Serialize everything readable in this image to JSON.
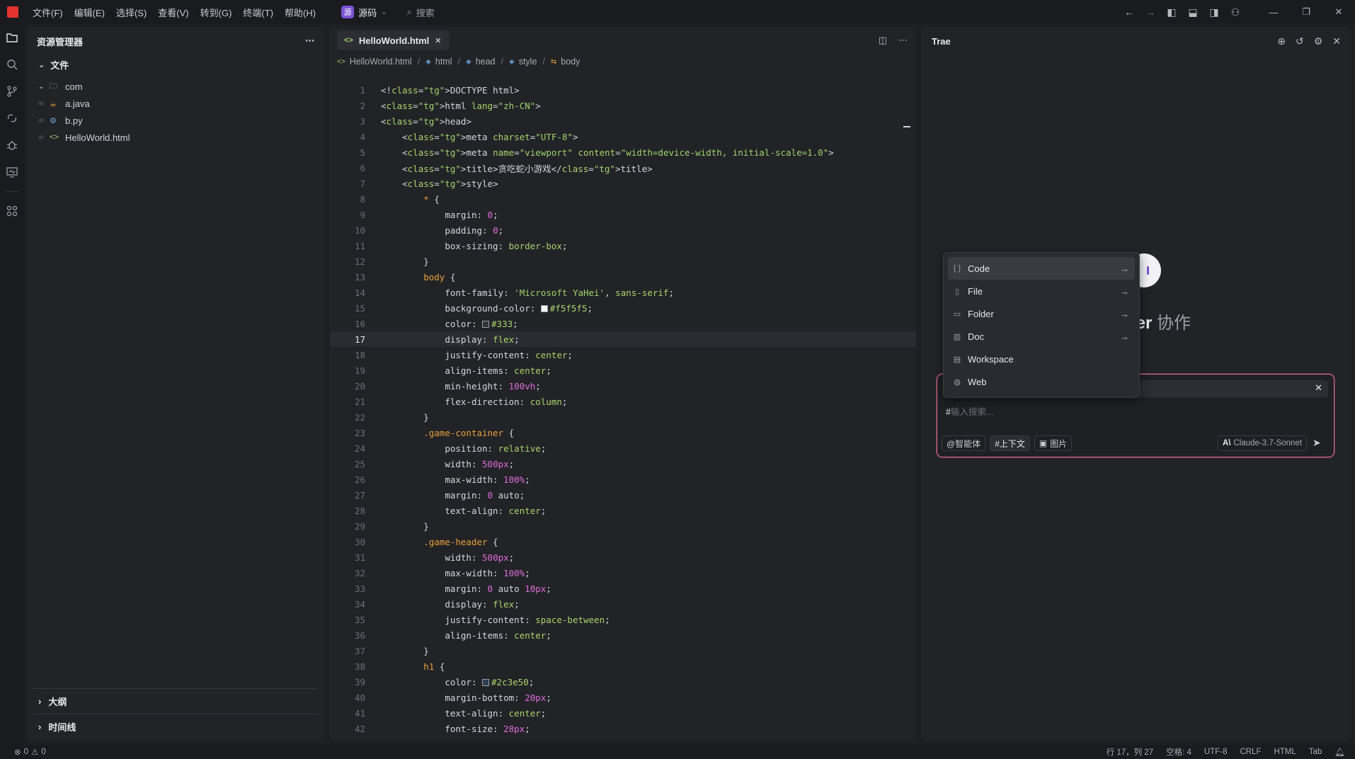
{
  "titlebar": {
    "menus": [
      "文件(F)",
      "编辑(E)",
      "选择(S)",
      "查看(V)",
      "转到(G)",
      "终端(T)",
      "帮助(H)"
    ],
    "source_badge": "源",
    "source_label": "源码",
    "search_label": "搜索"
  },
  "explorer": {
    "title": "资源管理器",
    "folder": "文件",
    "items": [
      {
        "name": "com",
        "type": "folder"
      },
      {
        "name": "a.java",
        "type": "java"
      },
      {
        "name": "b.py",
        "type": "python"
      },
      {
        "name": "HelloWorld.html",
        "type": "html"
      }
    ],
    "outline": "大纲",
    "timeline": "时间线"
  },
  "editor": {
    "tab": "HelloWorld.html",
    "breadcrumbs": [
      "HelloWorld.html",
      "html",
      "head",
      "style",
      "body"
    ],
    "current_line": 17,
    "lines": [
      "<!DOCTYPE html>",
      "<html lang=\"zh-CN\">",
      "<head>",
      "    <meta charset=\"UTF-8\">",
      "    <meta name=\"viewport\" content=\"width=device-width, initial-scale=1.0\">",
      "    <title>贪吃蛇小游戏</title>",
      "    <style>",
      "        * {",
      "            margin: 0;",
      "            padding: 0;",
      "            box-sizing: border-box;",
      "        }",
      "        body {",
      "            font-family: 'Microsoft YaHei', sans-serif;",
      "            background-color: #f5f5f5;",
      "            color: #333;",
      "            display: flex;",
      "            justify-content: center;",
      "            align-items: center;",
      "            min-height: 100vh;",
      "            flex-direction: column;",
      "        }",
      "        .game-container {",
      "            position: relative;",
      "            width: 500px;",
      "            max-width: 100%;",
      "            margin: 0 auto;",
      "            text-align: center;",
      "        }",
      "        .game-header {",
      "            width: 500px;",
      "            max-width: 100%;",
      "            margin: 0 auto 10px;",
      "            display: flex;",
      "            justify-content: space-between;",
      "            align-items: center;",
      "        }",
      "        h1 {",
      "            color: #2c3e50;",
      "            margin-bottom: 20px;",
      "            text-align: center;",
      "            font-size: 28px;"
    ]
  },
  "trae": {
    "title": "Trae",
    "welcome_bold": "ler",
    "welcome_rest": "协作",
    "popup_items": [
      {
        "label": "Code",
        "icon": "braces-icon",
        "arrow": true
      },
      {
        "label": "File",
        "icon": "file-icon",
        "arrow": true
      },
      {
        "label": "Folder",
        "icon": "folder-icon",
        "arrow": true
      },
      {
        "label": "Doc",
        "icon": "book-icon",
        "arrow": true
      },
      {
        "label": "Workspace",
        "icon": "workspace-icon",
        "arrow": false
      },
      {
        "label": "Web",
        "icon": "globe-icon",
        "arrow": false
      }
    ],
    "input_prefix": "#",
    "input_placeholder": "输入搜索...",
    "tool_agent": "@智能体",
    "tool_context": "#上下文",
    "tool_image": "图片",
    "model": "Claude-3.7-Sonnet"
  },
  "status": {
    "errors": "0",
    "warnings": "0",
    "position": "行 17，列 27",
    "spaces": "空格: 4",
    "encoding": "UTF-8",
    "eol": "CRLF",
    "language": "HTML",
    "indent": "Tab"
  },
  "colors": {
    "accent": "#7a52d1",
    "chat_border": "#e06c8a",
    "logo": "#e5322d"
  }
}
